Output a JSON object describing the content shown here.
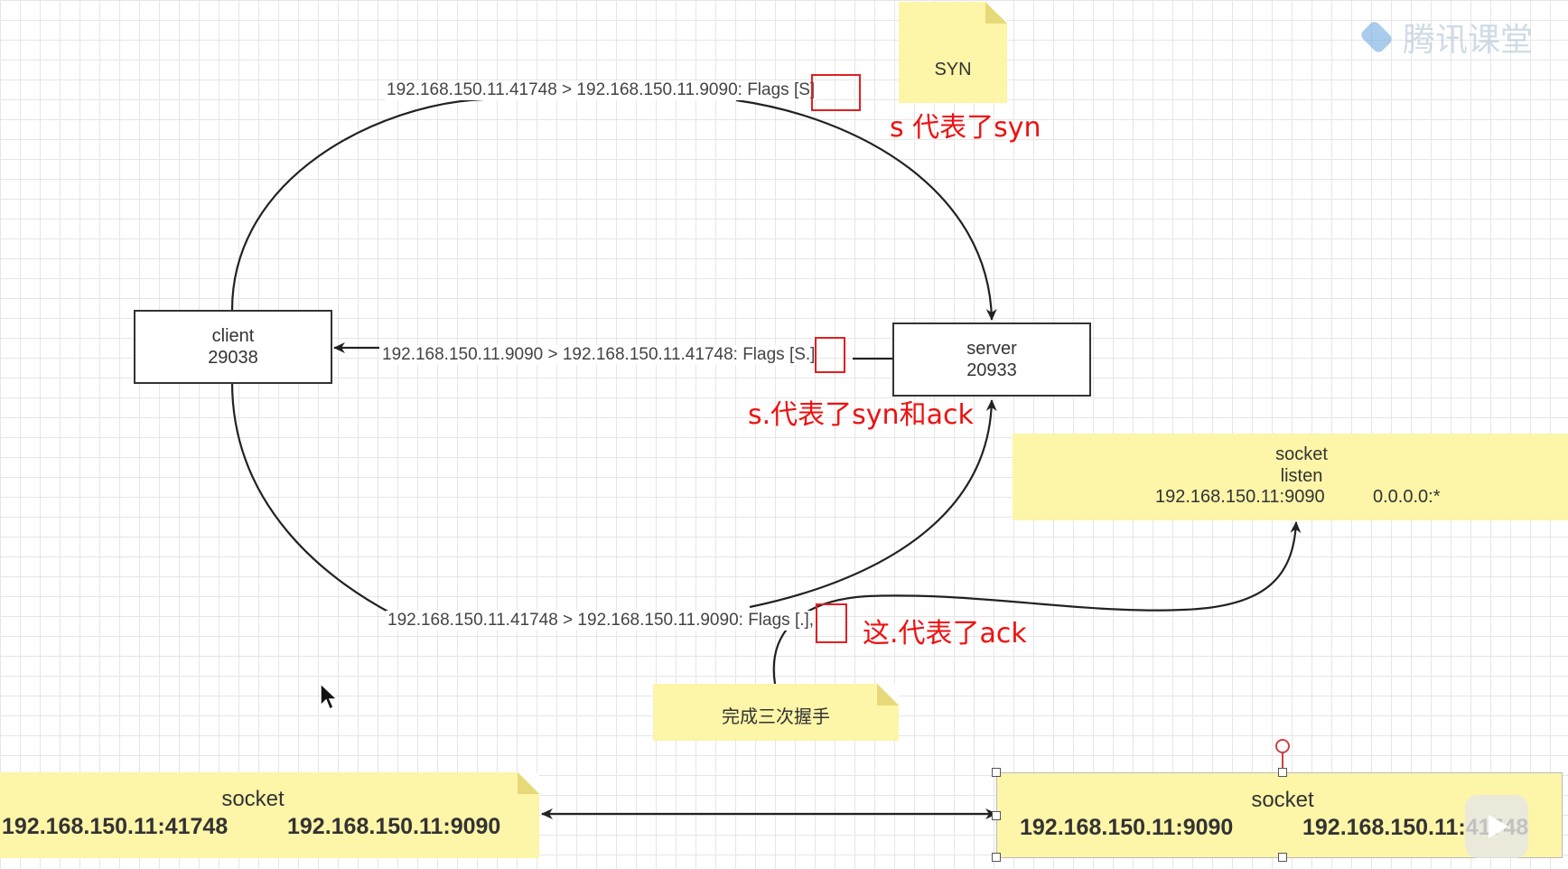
{
  "nodes": {
    "client": {
      "name": "client",
      "pid": "29038"
    },
    "server": {
      "name": "server",
      "pid": "20933"
    }
  },
  "notes": {
    "syn": "SYN",
    "handshake": "完成三次握手",
    "listen": {
      "title": "socket",
      "state": "listen",
      "local": "192.168.150.11:9090",
      "remote": "0.0.0.0:*"
    },
    "client_socket": {
      "title": "socket",
      "local": "192.168.150.11:41748",
      "remote": "192.168.150.11:9090"
    },
    "server_socket": {
      "title": "socket",
      "local": "192.168.150.11:9090",
      "remote": "192.168.150.11:41748"
    }
  },
  "packets": {
    "syn": {
      "text": "192.168.150.11.41748 > 192.168.150.11.9090: Flags",
      "flag": "[S]"
    },
    "synack": {
      "text": "192.168.150.11.9090 > 192.168.150.11.41748: Flags",
      "flag": "[S.]"
    },
    "ack": {
      "text": "192.168.150.11.41748 > 192.168.150.11.9090: Flags",
      "flag": "[.],"
    }
  },
  "annotations": {
    "syn": "s 代表了syn",
    "synack": "s.代表了syn和ack",
    "ack": "这.代表了ack"
  },
  "watermark": "腾讯课堂",
  "colors": {
    "note": "#fdf5a8",
    "annotation": "#ee1111",
    "edge": "#222222"
  }
}
